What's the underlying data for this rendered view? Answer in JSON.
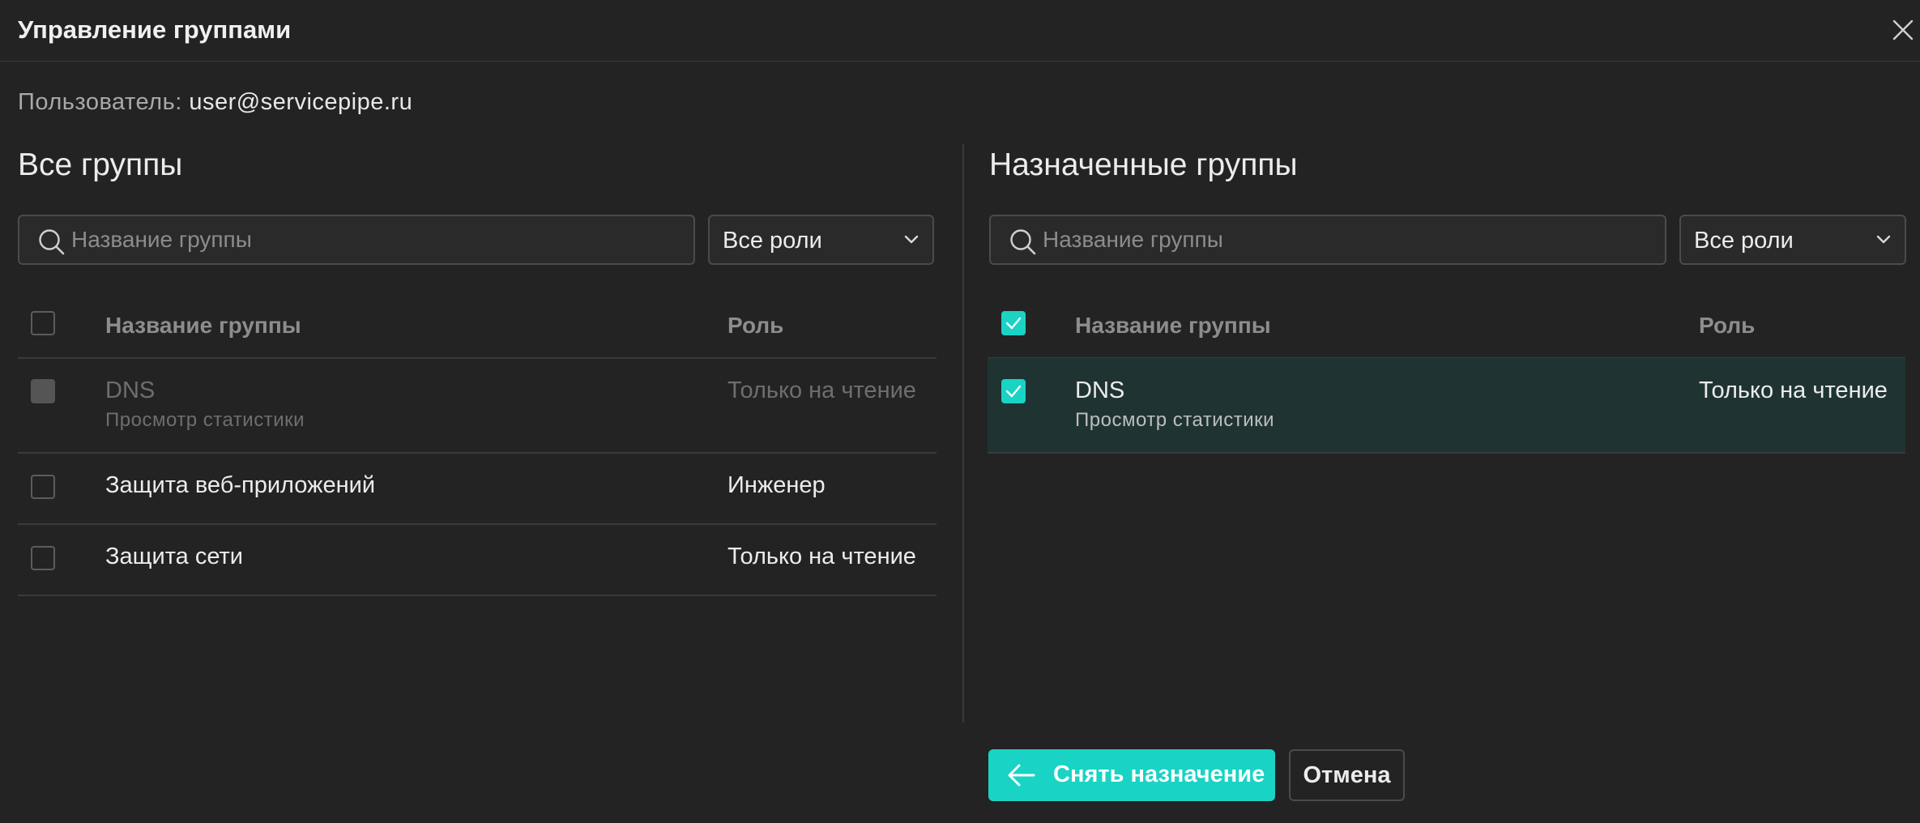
{
  "dialog": {
    "title": "Управление группами",
    "user_label": "Пользователь:",
    "user_value": "user@servicepipe.ru"
  },
  "all_groups": {
    "title": "Все группы",
    "search_placeholder": "Название группы",
    "role_filter": "Все роли",
    "columns": {
      "name": "Название группы",
      "role": "Роль"
    },
    "select_all_checked": false,
    "rows": [
      {
        "name": "DNS",
        "description": "Просмотр статистики",
        "role": "Только на чтение",
        "disabled": true,
        "checked": false
      },
      {
        "name": "Защита веб-приложений",
        "description": "",
        "role": "Инженер",
        "disabled": false,
        "checked": false
      },
      {
        "name": "Защита сети",
        "description": "",
        "role": "Только на чтение",
        "disabled": false,
        "checked": false
      }
    ]
  },
  "assigned_groups": {
    "title": "Назначенные группы",
    "search_placeholder": "Название группы",
    "role_filter": "Все роли",
    "columns": {
      "name": "Название группы",
      "role": "Роль"
    },
    "select_all_checked": true,
    "rows": [
      {
        "name": "DNS",
        "description": "Просмотр статистики",
        "role": "Только на чтение",
        "checked": true
      }
    ]
  },
  "actions": {
    "unassign_label": "Снять назначение",
    "cancel_label": "Отмена"
  },
  "colors": {
    "accent": "#19d3c5",
    "background": "#232323",
    "selected_row": "#1f3432"
  }
}
